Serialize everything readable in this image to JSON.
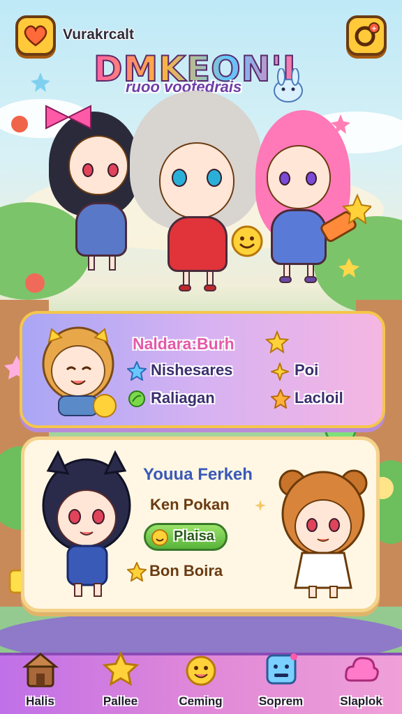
{
  "header": {
    "app_name": "Vurakrcalt",
    "logo_title": "DMKEON'I",
    "logo_subtitle": "ruoo vootedrais",
    "left_icon": "heart-icon",
    "right_icon": "chat-notification-icon"
  },
  "profile_panel": {
    "name": "Naldara:Burh",
    "stats": [
      {
        "icon": "blue-star-icon",
        "label": "Nishesares"
      },
      {
        "icon": "sparkle-icon",
        "label": "Poi"
      },
      {
        "icon": "leaf-icon",
        "label": "Raliagan"
      },
      {
        "icon": "star-icon",
        "label": "Lacloil"
      }
    ]
  },
  "detail_panel": {
    "title": "Youua Ferkeh",
    "subtitle": "Ken Pokan",
    "action_label": "Plaisa",
    "reward_label": "Bon Boira"
  },
  "nav": {
    "items": [
      {
        "label": "Halis",
        "icon": "house-icon"
      },
      {
        "label": "Pallee",
        "icon": "star-icon"
      },
      {
        "label": "Ceming",
        "icon": "sun-face-icon"
      },
      {
        "label": "Soprem",
        "icon": "robot-box-icon"
      },
      {
        "label": "Slaplok",
        "icon": "cloud-icon"
      }
    ]
  },
  "colors": {
    "accent_yellow": "#ffc93a",
    "panel_purple": "#c9aef2",
    "panel_cream": "#fff7e4",
    "nav_purple": "#c070e8",
    "title_pink": "#e45aa8"
  }
}
